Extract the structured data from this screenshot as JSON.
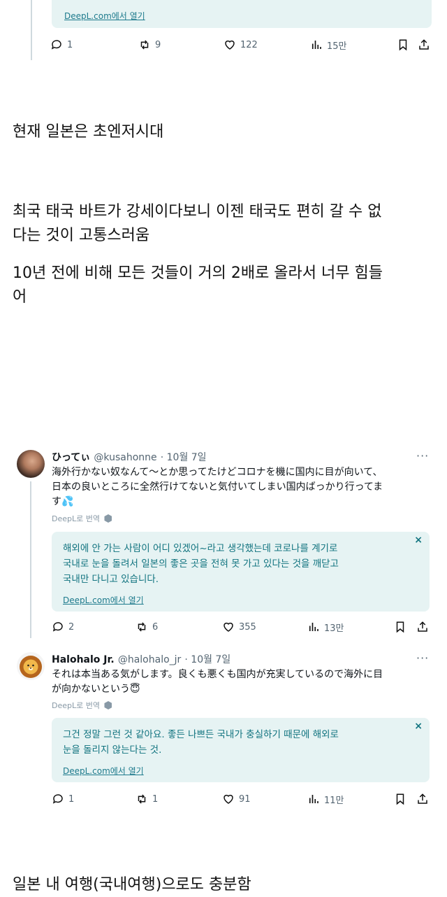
{
  "top_fragment": {
    "deepl_link": "DeepL.com에서 열기",
    "actions": {
      "replies": "1",
      "retweets": "9",
      "likes": "122",
      "views": "15만"
    }
  },
  "article": {
    "p1": "현재 일본은 초엔저시대",
    "p2_line1": "최국 태국 바트가 강세이다보니 이젠 태국도 편히 갈 수 없",
    "p2_line2": "다는 것이 고통스러움",
    "p3_line1": "10년 전에 비해 모든 것들이 거의 2배로 올라서 너무 힘들",
    "p3_line2": "어",
    "p4": "일본 내 여행(국내여행)으로도 충분함"
  },
  "tweet1": {
    "name": "ひってぃ",
    "handle": "@kusahonne",
    "date": "· 10월 7일",
    "more": "···",
    "body_line1": "海外行かない奴なんて〜とか思ってたけどコロナを機に国内に目が向いて、",
    "body_line2": "日本の良いところに全然行けてないと気付いてしまい国内ばっかり行ってま",
    "body_line3": "す",
    "emoji": "💦",
    "deepl_translate": "DeepL로 번역",
    "translation_line1": "해외에 안 가는 사람이 어디 있겠어~라고 생각했는데 코로나를 계기로",
    "translation_line2": "국내로 눈을 돌려서 일본의 좋은 곳을 전혀 못 가고 있다는 것을 깨닫고",
    "translation_line3": "국내만 다니고 있습니다.",
    "deepl_link": "DeepL.com에서 열기",
    "close": "×",
    "actions": {
      "replies": "2",
      "retweets": "6",
      "likes": "355",
      "views": "13만"
    }
  },
  "tweet2": {
    "name": "Halohalo Jr.",
    "handle": "@halohalo_jr",
    "date": "· 10월 7일",
    "more": "···",
    "body_line1": "それは本当ある気がします。良くも悪くも国内が充実しているので海外に目",
    "body_line2": "が向かないという",
    "emoji": "😇",
    "deepl_translate": "DeepL로 번역",
    "translation_line1": "그건 정말 그런 것 같아요. 좋든 나쁘든 국내가 충실하기 때문에 해외로",
    "translation_line2": "눈을 돌리지 않는다는 것.",
    "deepl_link": "DeepL.com에서 열기",
    "close": "×",
    "actions": {
      "replies": "1",
      "retweets": "1",
      "likes": "91",
      "views": "11만"
    }
  }
}
